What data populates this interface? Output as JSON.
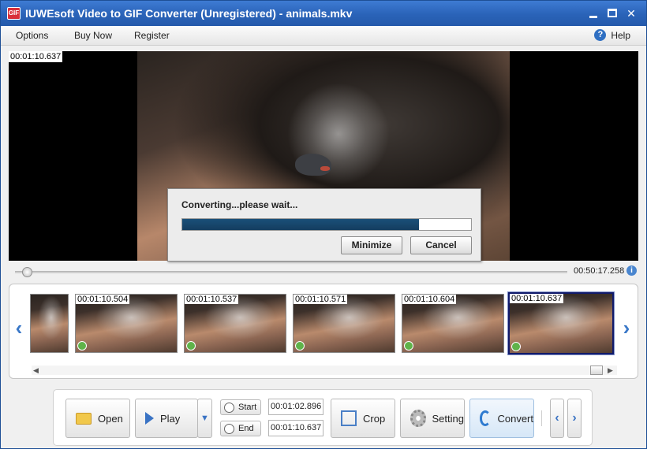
{
  "window": {
    "title": "IUWEsoft Video to GIF Converter (Unregistered) - animals.mkv"
  },
  "menu": {
    "items": [
      "Options",
      "Buy Now",
      "Register"
    ],
    "help": "Help"
  },
  "video": {
    "current_time": "00:01:10.637",
    "duration": "00:50:17.258",
    "playhead_fraction": 0.02
  },
  "dialog": {
    "message": "Converting...please wait...",
    "progress": 0.82,
    "minimize_label": "Minimize",
    "cancel_label": "Cancel"
  },
  "thumbnails": [
    {
      "time": ""
    },
    {
      "time": "00:01:10.504"
    },
    {
      "time": "00:01:10.537"
    },
    {
      "time": "00:01:10.571"
    },
    {
      "time": "00:01:10.604"
    },
    {
      "time": "00:01:10.637",
      "selected": true
    }
  ],
  "toolbar": {
    "open_label": "Open",
    "play_label": "Play",
    "start_label": "Start",
    "end_label": "End",
    "start_time": "00:01:02.896",
    "end_time": "00:01:10.637",
    "crop_label": "Crop",
    "setting_label": "Setting",
    "convert_label": "Convert"
  },
  "icons": {
    "app": "video-gif-icon",
    "help": "help-icon",
    "info": "info-icon",
    "open": "folder-icon",
    "play": "play-icon",
    "crop": "crop-icon",
    "setting": "gear-icon",
    "convert": "convert-icon"
  }
}
